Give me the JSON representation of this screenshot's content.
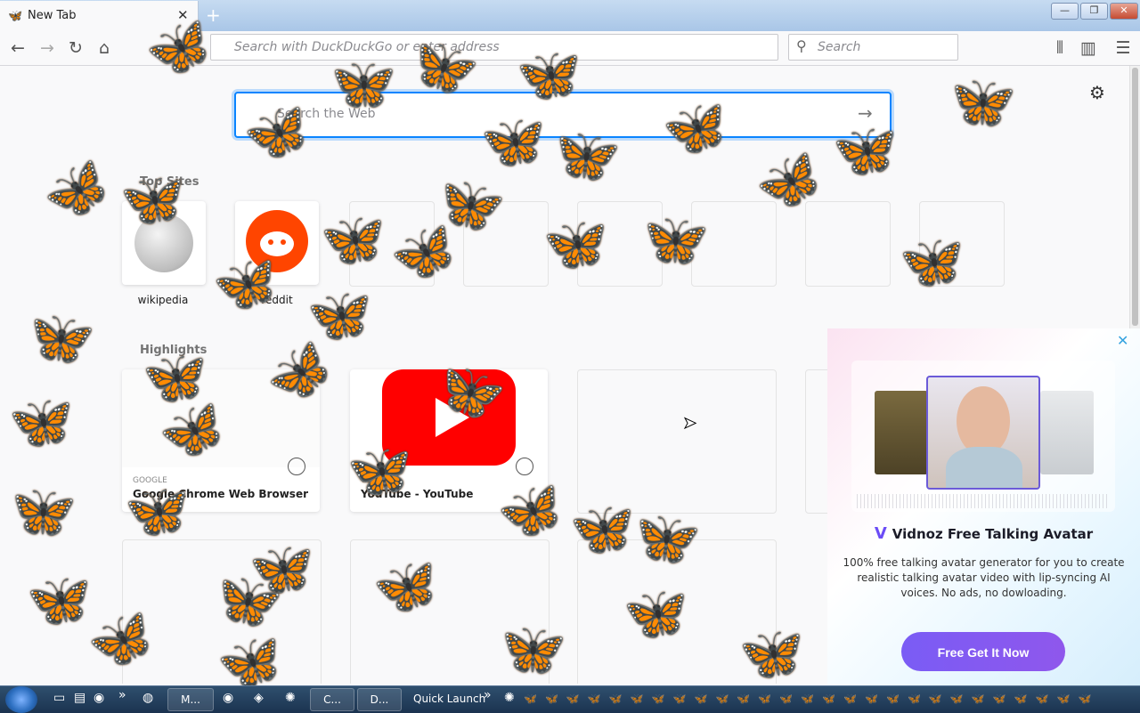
{
  "tab": {
    "title": "New Tab",
    "favicon": "🦋",
    "close": "✕",
    "new_tab": "+"
  },
  "window": {
    "minimize": "—",
    "restore": "❐",
    "close": "✕"
  },
  "nav": {
    "back": "←",
    "forward": "→",
    "reload": "↻",
    "home": "⌂",
    "library": "⫴",
    "sidebar": "▥",
    "menu": "☰"
  },
  "urlbar": {
    "placeholder": "Search with DuckDuckGo or enter address"
  },
  "searchbar": {
    "placeholder": "Search",
    "icon": "⚲"
  },
  "newtab": {
    "search_placeholder": "Search the Web",
    "search_arrow": "→",
    "settings_icon": "⚙",
    "top_sites_heading": "Top Sites",
    "top_sites": [
      {
        "label": "wikipedia"
      },
      {
        "label": "reddit"
      }
    ],
    "highlights_heading": "Highlights",
    "highlights": [
      {
        "title": "Google Chrome Web Browser",
        "source": "GOOGLE"
      },
      {
        "title": "YouTube - YouTube",
        "source": "YOUTUBE"
      }
    ]
  },
  "popup": {
    "close": "✕",
    "title": "Vidnoz Free Talking Avatar",
    "logo": "V",
    "description": "100% free talking avatar generator for you to create realistic talking avatar video with lip-syncing AI voices. No ads, no dowloading.",
    "cta": "Free Get It Now"
  },
  "taskbar": {
    "start": "",
    "buttons": [
      {
        "label": "M..."
      },
      {
        "label": "C..."
      },
      {
        "label": "D..."
      }
    ],
    "quick_launch": "Quick Launch",
    "chevron": "»"
  },
  "colors": {
    "accent": "#0a84ff",
    "butterfly": "#e67410",
    "cta": "#7a5cf5"
  }
}
